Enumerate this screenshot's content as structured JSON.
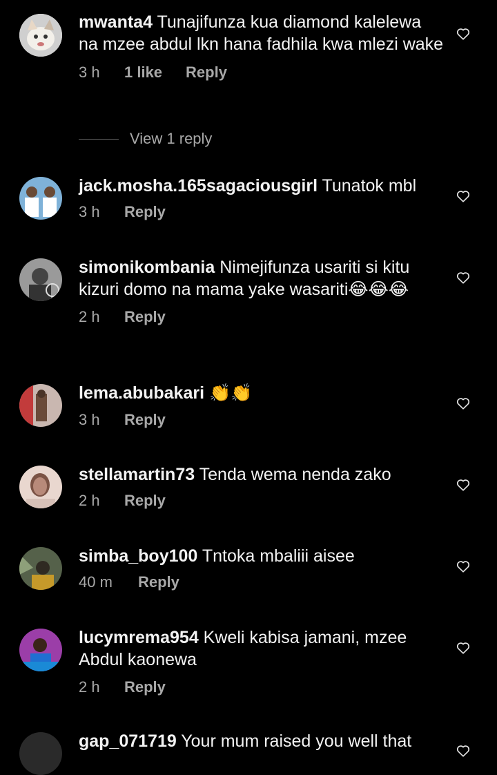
{
  "comments": [
    {
      "user": "mwanta4",
      "text": " Tunajifunza kua diamond kalelewa na mzee abdul lkn hana fadhila kwa mlezi wake",
      "time": "3 h",
      "likes": "1 like",
      "reply": "Reply"
    },
    {
      "user": "jack.mosha.165sagaciousgirl",
      "text": " Tunatok mbl",
      "time": "3 h",
      "reply": "Reply"
    },
    {
      "user": "simonikombania",
      "text": " Nimejifunza usariti si kitu kizuri domo na mama yake wasariti",
      "emoji": "😂😂😂",
      "time": "2 h",
      "reply": "Reply"
    },
    {
      "user": "lema.abubakari",
      "text": " ",
      "emoji": "👏👏",
      "time": "3 h",
      "reply": "Reply"
    },
    {
      "user": "stellamartin73",
      "text": " Tenda wema nenda zako",
      "time": "2 h",
      "reply": "Reply"
    },
    {
      "user": "simba_boy100",
      "text": " Tntoka mbaliii aisee",
      "time": "40 m",
      "reply": "Reply"
    },
    {
      "user": "lucymrema954",
      "text": " Kweli kabisa jamani, mzee Abdul kaonewa",
      "time": "2 h",
      "reply": "Reply"
    },
    {
      "user": "gap_071719",
      "text": " Your mum raised you well that",
      "time": "",
      "reply": ""
    }
  ],
  "view_replies": "View 1 reply",
  "icons": {
    "like": "heart-outline-icon",
    "emoji_laugh": "tears-of-joy-emoji",
    "emoji_clap": "clapping-hands-emoji"
  }
}
